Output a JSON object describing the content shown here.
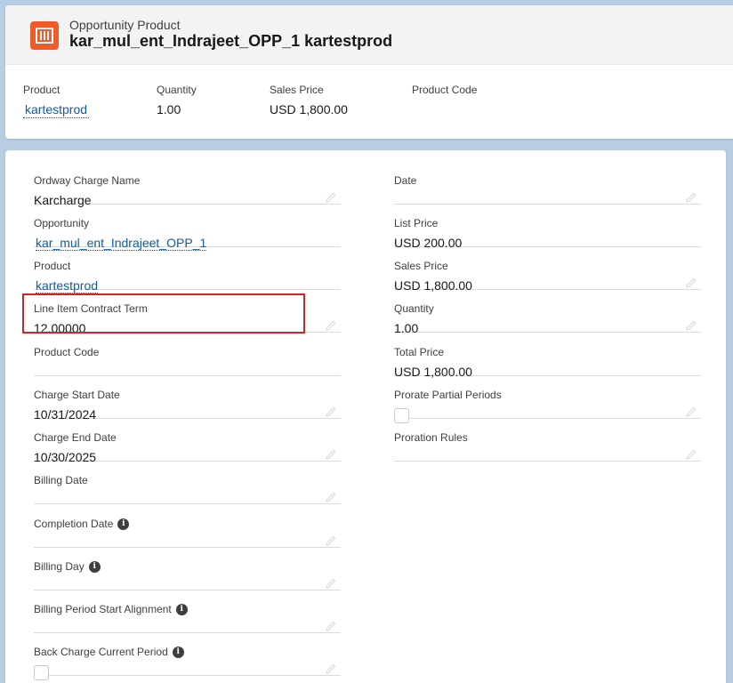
{
  "header": {
    "object_type": "Opportunity Product",
    "title": "kar_mul_ent_Indrajeet_OPP_1 kartestprod",
    "icon": "product-icon",
    "icon_color": "#f15a29",
    "highlights": [
      {
        "label": "Product",
        "value": "kartestprod",
        "link": true
      },
      {
        "label": "Quantity",
        "value": "1.00",
        "link": false
      },
      {
        "label": "Sales Price",
        "value": "USD 1,800.00",
        "link": false
      },
      {
        "label": "Product Code",
        "value": "",
        "link": false
      }
    ]
  },
  "details": {
    "left": [
      {
        "label": "Ordway Charge Name",
        "value": "Karcharge",
        "editable": true
      },
      {
        "label": "Opportunity",
        "value": "kar_mul_ent_Indrajeet_OPP_1",
        "link": true,
        "editable": false
      },
      {
        "label": "Product",
        "value": "kartestprod",
        "link": true,
        "editable": false
      },
      {
        "label": "Line Item Contract Term",
        "value": "12.00000",
        "editable": true,
        "highlighted": true
      },
      {
        "label": "Product Code",
        "value": "",
        "editable": false
      },
      {
        "label": "Charge Start Date",
        "value": "10/31/2024",
        "editable": true
      },
      {
        "label": "Charge End Date",
        "value": "10/30/2025",
        "editable": true
      },
      {
        "label": "Billing Date",
        "value": "",
        "editable": true
      },
      {
        "label": "Completion Date",
        "value": "",
        "editable": true,
        "info": true
      },
      {
        "label": "Billing Day",
        "value": "",
        "editable": true,
        "info": true
      },
      {
        "label": "Billing Period Start Alignment",
        "value": "",
        "editable": true,
        "info": true
      },
      {
        "label": "Back Charge Current Period",
        "value": "",
        "editable": true,
        "info": true,
        "checkbox": true
      }
    ],
    "right": [
      {
        "label": "Date",
        "value": "",
        "editable": true
      },
      {
        "label": "List Price",
        "value": "USD 200.00",
        "editable": false
      },
      {
        "label": "Sales Price",
        "value": "USD 1,800.00",
        "editable": true
      },
      {
        "label": "Quantity",
        "value": "1.00",
        "editable": true
      },
      {
        "label": "Total Price",
        "value": "USD 1,800.00",
        "editable": false
      },
      {
        "label": "Prorate Partial Periods",
        "value": "",
        "editable": true,
        "checkbox": true
      },
      {
        "label": "Proration Rules",
        "value": "",
        "editable": true
      }
    ]
  },
  "colors": {
    "link": "#0b5cab",
    "highlight_border": "#e02020",
    "background": "#b7cde3"
  }
}
